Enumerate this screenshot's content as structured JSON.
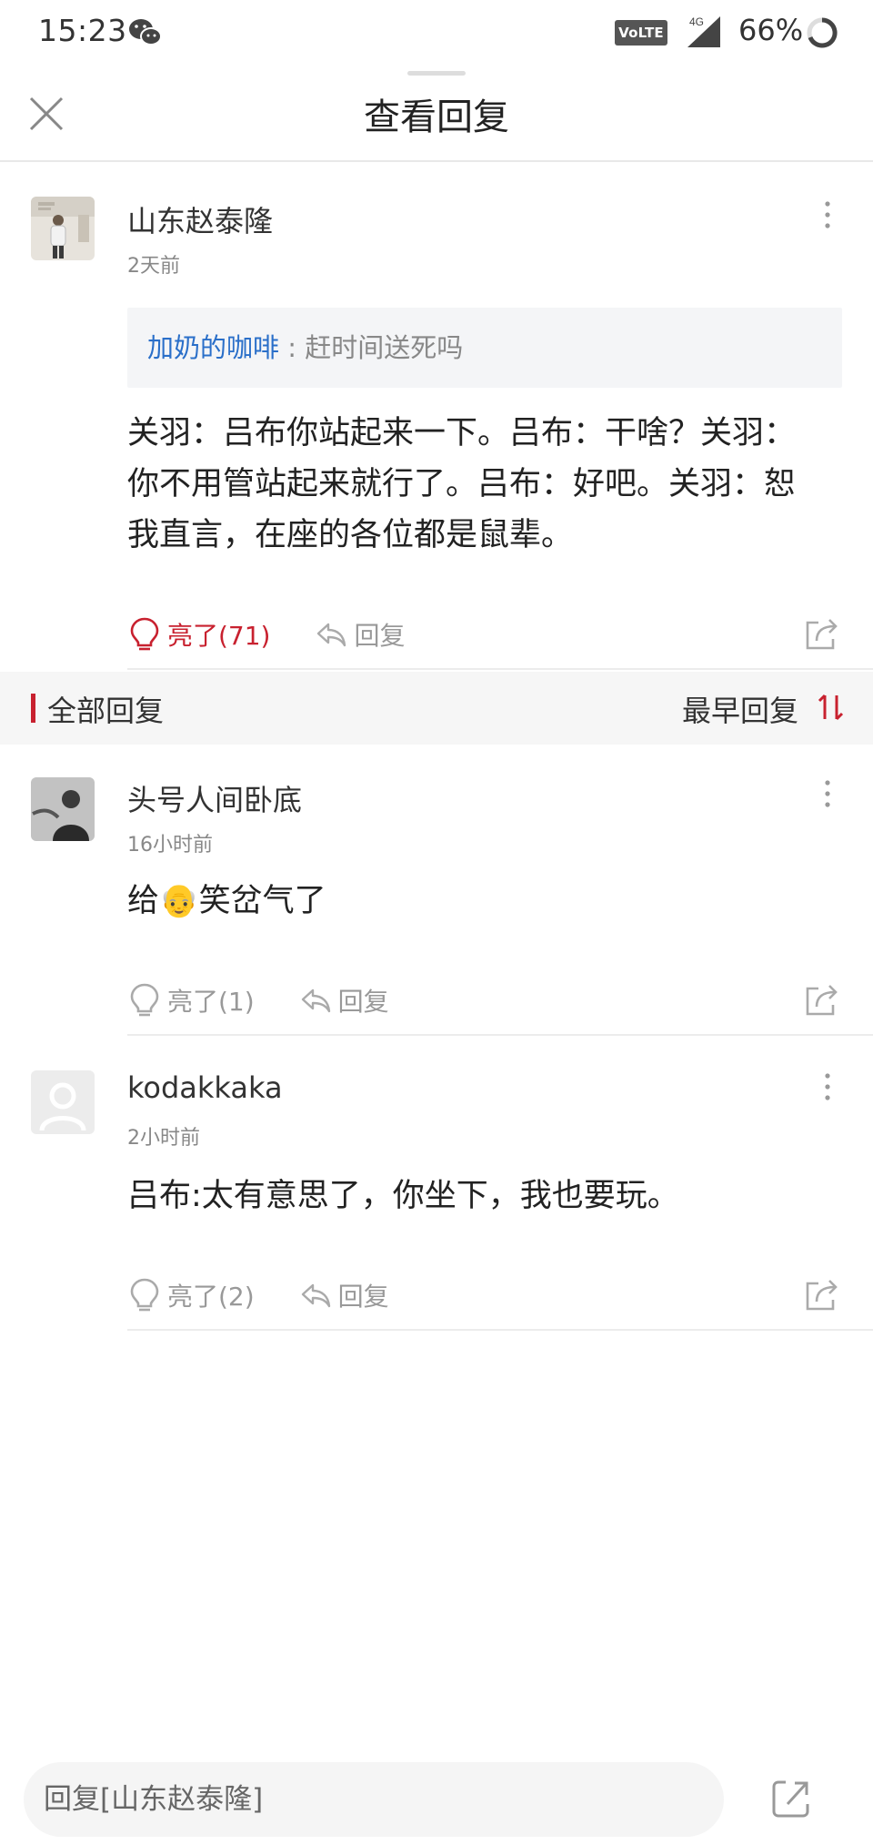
{
  "status_bar": {
    "time": "15:23",
    "network_badge": "VoLTE",
    "network_type": "4G",
    "battery": "66%"
  },
  "header": {
    "title": "查看回复",
    "close_icon": "close-icon"
  },
  "original_comment": {
    "username": "山东赵泰隆",
    "time": "2天前",
    "quote": {
      "user": "加奶的咖啡",
      "separator": ":",
      "text": "赶时间送死吗"
    },
    "content_lines": [
      "关羽：吕布你站起来一下。吕布：干啥？关羽：",
      "你不用管站起来就行了。吕布：好吧。关羽：恕",
      "我直言，在座的各位都是鼠辈。"
    ],
    "light_label": "亮了(71)",
    "reply_label": "回复",
    "lit": true
  },
  "section": {
    "title": "全部回复",
    "sort_label": "最早回复"
  },
  "replies": [
    {
      "username": "头号人间卧底",
      "time": "16小时前",
      "content_prefix": "给",
      "content_emoji": "👴",
      "content_suffix": "笑岔气了",
      "light_label": "亮了(1)",
      "reply_label": "回复"
    },
    {
      "username": "kodakkaka",
      "time": "2小时前",
      "content": "吕布:太有意思了，你坐下，我也要玩。",
      "light_label": "亮了(2)",
      "reply_label": "回复"
    }
  ],
  "bottom_bar": {
    "input_placeholder": "回复[山东赵泰隆]"
  },
  "colors": {
    "accent_red": "#c8212f",
    "link_blue": "#2a6fc9",
    "muted_gray": "#999999"
  }
}
